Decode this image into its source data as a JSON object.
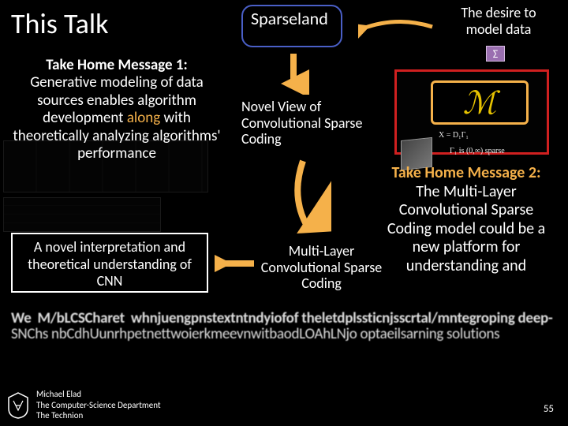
{
  "title": "This Talk",
  "sparseland": "Sparseland",
  "right_title": "The desire to model data",
  "msg1": {
    "head": "Take Home Message 1:",
    "body_pre": "Generative modeling of data sources enables algorithm development ",
    "along": "along",
    "body_post": " with theoretically analyzing algorithms' performance"
  },
  "novel_view": "Novel View of Convolutional Sparse Coding",
  "msg2": {
    "head": "Take Home Message 2:",
    "body": "The Multi-Layer Convolutional Sparse Coding model could be a new platform for understanding and"
  },
  "cnn_box": "A novel interpretation and theoretical understanding of CNN",
  "mlcsc": "Multi-Layer Convolutional Sparse Coding",
  "smeared": {
    "line1": "We  M/bLCSCharet  whnjuengpnstextntndyiofof theletdplssticnjsscrtal/mntegroping deep-",
    "line2": "SNChs nbCdhUunrhpetnettwoierkmeevnwitbaodLOAhLNjo optaeilsarning solutions",
    "line3": "We presented a theoretical study of the CSC model and"
  },
  "sigma": "Σ",
  "M": "ℳ",
  "eqn1": "X = D₁Γ₁",
  "eqn2": "Γ₁ is (0,∞) sparse",
  "footer": {
    "name": "Michael Elad",
    "dept": "The Computer-Science Department",
    "inst": "The Technion"
  },
  "page": "55"
}
